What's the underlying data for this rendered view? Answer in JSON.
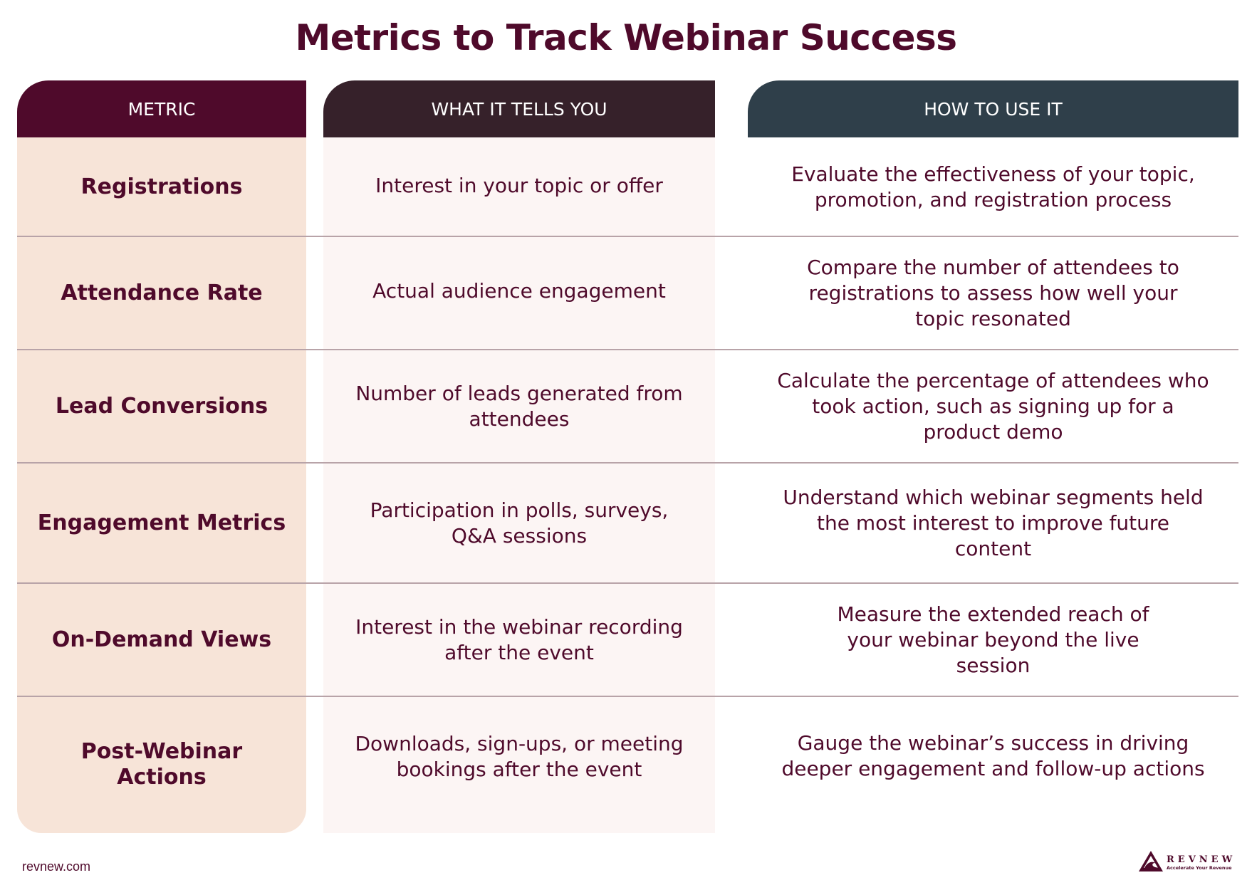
{
  "title": "Metrics to Track Webinar Success",
  "columns": {
    "metric": "METRIC",
    "what": "WHAT IT TELLS YOU",
    "how": "HOW TO USE IT"
  },
  "rows": [
    {
      "metric": "Registrations",
      "what": "Interest in your topic or offer",
      "how": "Evaluate the effectiveness of your topic, promotion, and registration process"
    },
    {
      "metric": "Attendance Rate",
      "what": "Actual audience engagement",
      "how": "Compare the number of attendees to registrations to assess how well your topic resonated"
    },
    {
      "metric": "Lead Conversions",
      "what": "Number of leads generated from attendees",
      "how": "Calculate the percentage of attendees who took action, such as signing up for a product demo"
    },
    {
      "metric": "Engagement Metrics",
      "what": "Participation in polls, surveys, Q&A sessions",
      "how": "Understand which webinar segments held the most interest to improve future content"
    },
    {
      "metric": "On-Demand Views",
      "what": "Interest in the webinar recording after the event",
      "how": "Measure the extended reach of your webinar beyond the live session"
    },
    {
      "metric": "Post-Webinar Actions",
      "what": "Downloads, sign-ups, or meeting bookings after the event",
      "how": "Gauge the webinar’s success in driving deeper engagement and follow-up actions"
    }
  ],
  "footer": {
    "url": "revnew.com",
    "logo_name": "REVNEW",
    "logo_tagline": "Accelerate Your Revenue",
    "logo_icon": "mountain-wave-triangle-icon"
  },
  "colors": {
    "brand": "#4f0a2b",
    "header_what": "#36212a",
    "header_how": "#2f3f4a",
    "metric_bg": "#f7e4d8",
    "what_bg": "#fcf5f4"
  }
}
